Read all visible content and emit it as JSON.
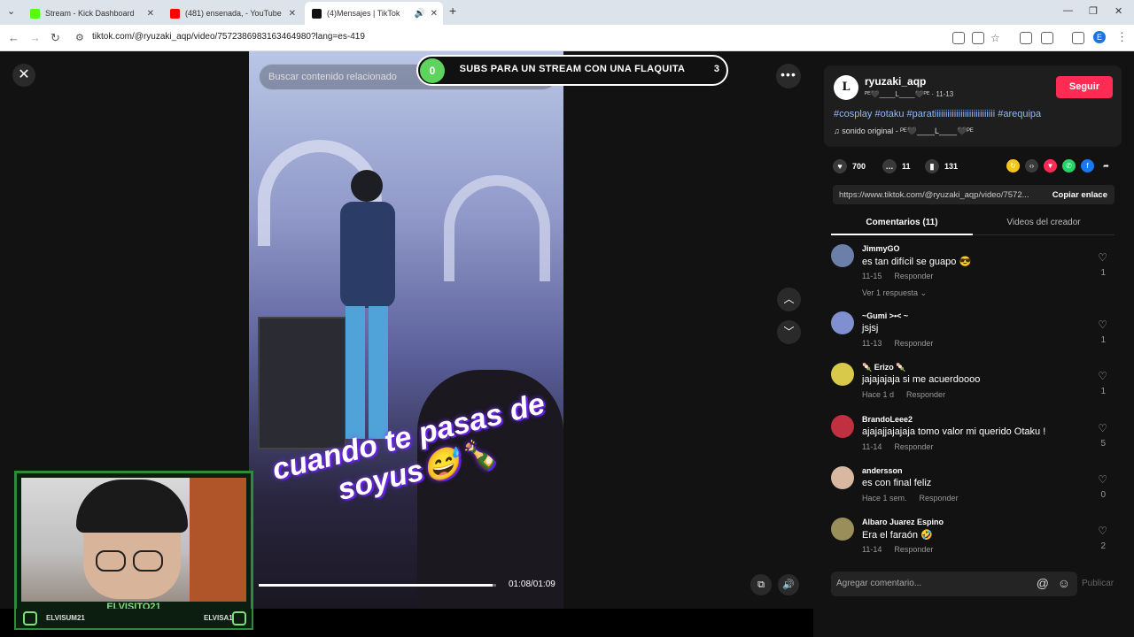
{
  "browser": {
    "tabs": [
      {
        "title": "Stream - Kick Dashboard",
        "favicon_color": "#53fc18"
      },
      {
        "title": "(481) ensenada, - YouTube",
        "favicon_color": "#ff0000"
      },
      {
        "title": "(4)Mensajes | TikTok",
        "favicon_color": "#111111"
      }
    ],
    "new_tab": "+",
    "url": "tiktok.com/@ryuzaki_aqp/video/7572386983163464980?lang=es-419",
    "profile_initial": "E"
  },
  "viewer": {
    "close_icon": "✕",
    "search_placeholder": "Buscar contenido relacionado",
    "subs_overlay": {
      "current": "0",
      "text": "SUBS PARA UN STREAM CON UNA FLAQUITA",
      "goal": "3"
    },
    "more_icon": "•••",
    "up_icon": "︿",
    "down_icon": "﹀",
    "caption_line1": "cuando te pasas de",
    "caption_line2": "soyus😅🍾",
    "progress": 0.985,
    "timecode": "01:08/01:09",
    "webcam_name": "ELVISITO21",
    "webcam_instagram": "ELVISUM21",
    "webcam_discord": "ELVISA1"
  },
  "panel": {
    "creator": {
      "avatar_letter": "L",
      "username": "ryuzaki_aqp",
      "subtitle": "ᴾᴱ🖤____L____🖤ᴾᴱ · 11-13",
      "follow_label": "Seguir",
      "hashtags": "#cosplay #otaku #parati​iiiiiiiiiiiiiiiiiiiiiiiiiii #arequipa",
      "sound": "♫  sonido original - ᴾᴱ🖤____L____🖤ᴾᴱ"
    },
    "stats": {
      "likes": "700",
      "comments": "11",
      "saves": "131"
    },
    "share_colors": [
      "#f5c518",
      "#3a3a3a",
      "#fe2c55",
      "#25d366",
      "#1877f2"
    ],
    "link": "https://www.tiktok.com/@ryuzaki_aqp/video/7572...",
    "copy_label": "Copiar enlace",
    "tabs": {
      "comments": "Comentarios (11)",
      "creator_videos": "Videos del creador"
    },
    "comments": [
      {
        "user": "JimmyGO",
        "text": "es tan difícil se guapo 😎",
        "date": "11-15",
        "reply": "Responder",
        "likes": "1",
        "more": "Ver 1 respuesta ⌄",
        "avatar_color": "#6b7fa8"
      },
      {
        "user": "~Gumi >•< ~",
        "text": "jsjsj",
        "date": "11-13",
        "reply": "Responder",
        "likes": "1",
        "more": "",
        "avatar_color": "#7f8fd0"
      },
      {
        "user": "🍡 Erizo 🍡",
        "text": "jajajajaja si me acuerdoooo",
        "date": "Hace 1 d",
        "reply": "Responder",
        "likes": "1",
        "more": "",
        "avatar_color": "#d9c94a"
      },
      {
        "user": "BrandoLeee2",
        "text": "ajajajjajajaja tomo valor mi querido Otaku !",
        "date": "11-14",
        "reply": "Responder",
        "likes": "5",
        "more": "",
        "avatar_color": "#c03040"
      },
      {
        "user": "andersson",
        "text": "es con final feliz",
        "date": "Hace 1 sem.",
        "reply": "Responder",
        "likes": "0",
        "more": "",
        "avatar_color": "#d8b8a0"
      },
      {
        "user": "Albaro Juarez Espino",
        "text": "Era el faraón 🤣",
        "date": "11-14",
        "reply": "Responder",
        "likes": "2",
        "more": "",
        "avatar_color": "#9a8f5a"
      }
    ],
    "composer_placeholder": "Agregar comentario...",
    "publish_label": "Publicar"
  }
}
